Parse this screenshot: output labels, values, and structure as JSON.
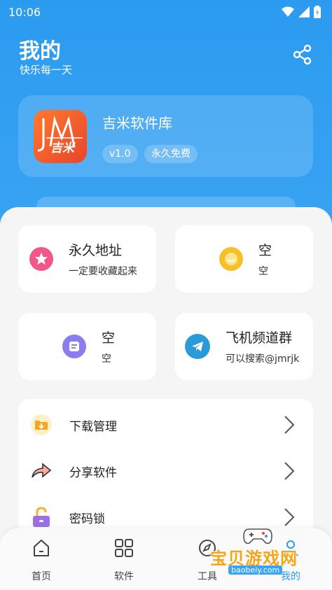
{
  "status_bar": {
    "time": "10:06"
  },
  "header": {
    "title": "我的",
    "subtitle": "快乐每一天"
  },
  "app": {
    "name": "吉米软件库",
    "logo_text": "吉米",
    "version": "v1.0",
    "license": "永久免费"
  },
  "tiles": [
    {
      "title": "永久地址",
      "subtitle": "一定要收藏起来",
      "icon": "star-icon",
      "color": "#f2578a"
    },
    {
      "title": "空",
      "subtitle": "空",
      "icon": "smile-icon",
      "color": "#f5c02a"
    },
    {
      "title": "空",
      "subtitle": "空",
      "icon": "note-icon",
      "color": "#8b7cf0"
    },
    {
      "title": "飞机频道群",
      "subtitle": "可以搜索@jmrjk",
      "icon": "telegram-icon",
      "color": "#2a9ad8"
    }
  ],
  "menu": [
    {
      "label": "下载管理",
      "icon": "download-folder-icon"
    },
    {
      "label": "分享软件",
      "icon": "share-arrow-icon"
    },
    {
      "label": "密码锁",
      "icon": "lock-icon"
    }
  ],
  "nav": [
    {
      "label": "首页",
      "icon": "home-icon"
    },
    {
      "label": "软件",
      "icon": "grid-icon"
    },
    {
      "label": "工具",
      "icon": "compass-icon"
    },
    {
      "label": "我的",
      "icon": "profile-icon"
    }
  ],
  "watermark": {
    "text": "宝贝游戏网",
    "url": "baobeiy.com"
  }
}
